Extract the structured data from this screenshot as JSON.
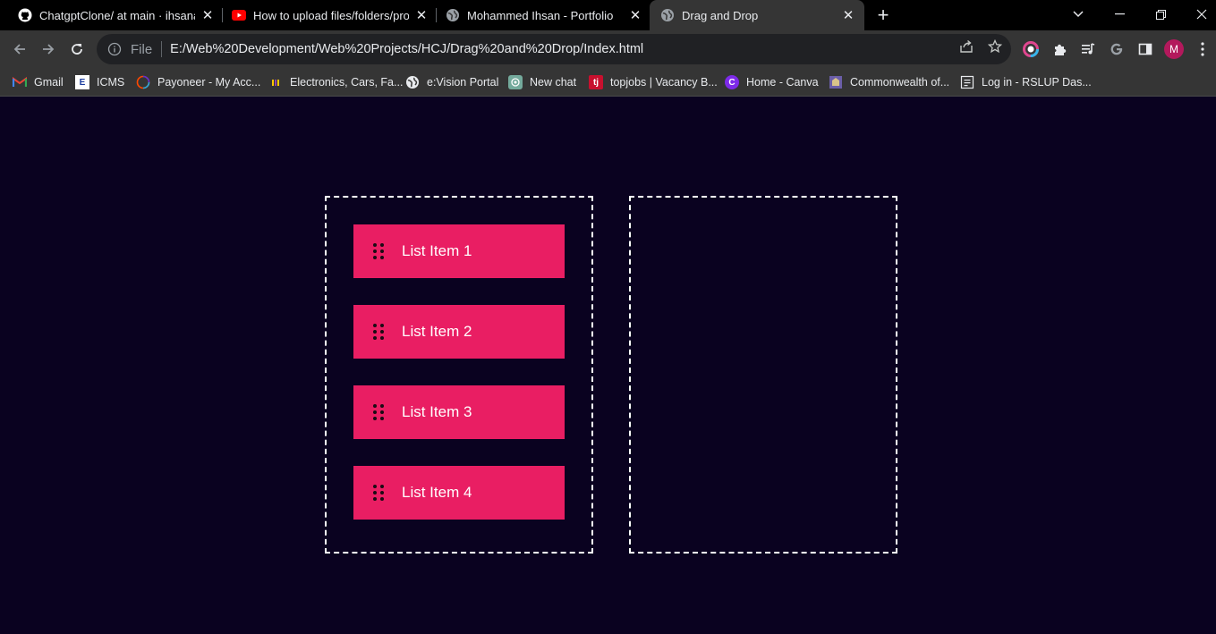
{
  "tabs": [
    {
      "title": "ChatgptClone/ at main · ihsanakr",
      "icon": "github-icon",
      "active": false
    },
    {
      "title": "How to upload files/folders/proje",
      "icon": "youtube-icon",
      "active": false
    },
    {
      "title": "Mohammed Ihsan - Portfolio",
      "icon": "globe-icon",
      "active": false
    },
    {
      "title": "Drag and Drop",
      "icon": "globe-icon",
      "active": true
    }
  ],
  "address_bar": {
    "scheme_label": "File",
    "url": "E:/Web%20Development/Web%20Projects/HCJ/Drag%20and%20Drop/Index.html"
  },
  "profile": {
    "initial": "M"
  },
  "bookmarks": [
    {
      "label": "Gmail",
      "icon": "gmail-icon"
    },
    {
      "label": "ICMS",
      "icon": "icms-icon"
    },
    {
      "label": "Payoneer - My Acc...",
      "icon": "payoneer-icon"
    },
    {
      "label": "Electronics, Cars, Fa...",
      "icon": "ikman-icon"
    },
    {
      "label": "e:Vision Portal",
      "icon": "globe-icon"
    },
    {
      "label": "New chat",
      "icon": "chatgpt-icon"
    },
    {
      "label": "topjobs | Vacancy B...",
      "icon": "topjobs-icon"
    },
    {
      "label": "Home - Canva",
      "icon": "canva-icon"
    },
    {
      "label": "Commonwealth of...",
      "icon": "commonwealth-icon"
    },
    {
      "label": "Log in - RSLUP Das...",
      "icon": "page-icon"
    }
  ],
  "list": {
    "items": [
      {
        "label": "List Item 1"
      },
      {
        "label": "List Item 2"
      },
      {
        "label": "List Item 3"
      },
      {
        "label": "List Item 4"
      }
    ]
  },
  "colors": {
    "page_background": "#0a0220",
    "item_background": "#e91e63",
    "dropzone_border": "#ffffff"
  }
}
